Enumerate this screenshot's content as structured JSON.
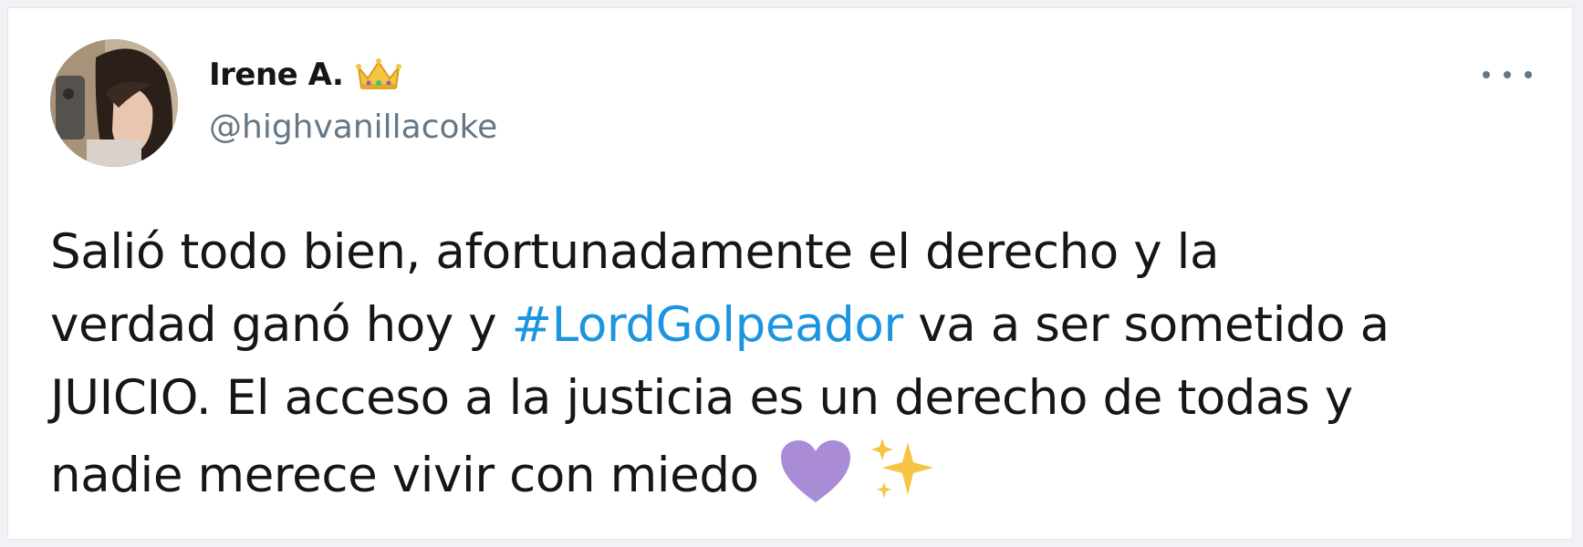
{
  "tweet": {
    "author": {
      "display_name": "Irene A.",
      "handle": "@highvanillacoke",
      "badge_icon": "crown-emoji"
    },
    "more_menu_icon": "ellipsis-icon",
    "text_parts": {
      "line1": "Salió todo bien, afortunadamente el derecho y la",
      "line2_before": "verdad ganó hoy y ",
      "hashtag": "#LordGolpeador",
      "line2_after": " va a ser sometido a",
      "line3": "JUICIO. El acceso a la justicia es un derecho de todas y",
      "line4": "nadie merece vivir con miedo"
    },
    "emojis": [
      "purple-heart-emoji",
      "sparkles-emoji"
    ],
    "colors": {
      "hashtag": "#1b95e0",
      "text": "#14171a",
      "secondary": "#657786",
      "heart": "#a98bd6",
      "sparkles": "#f6c445"
    }
  }
}
